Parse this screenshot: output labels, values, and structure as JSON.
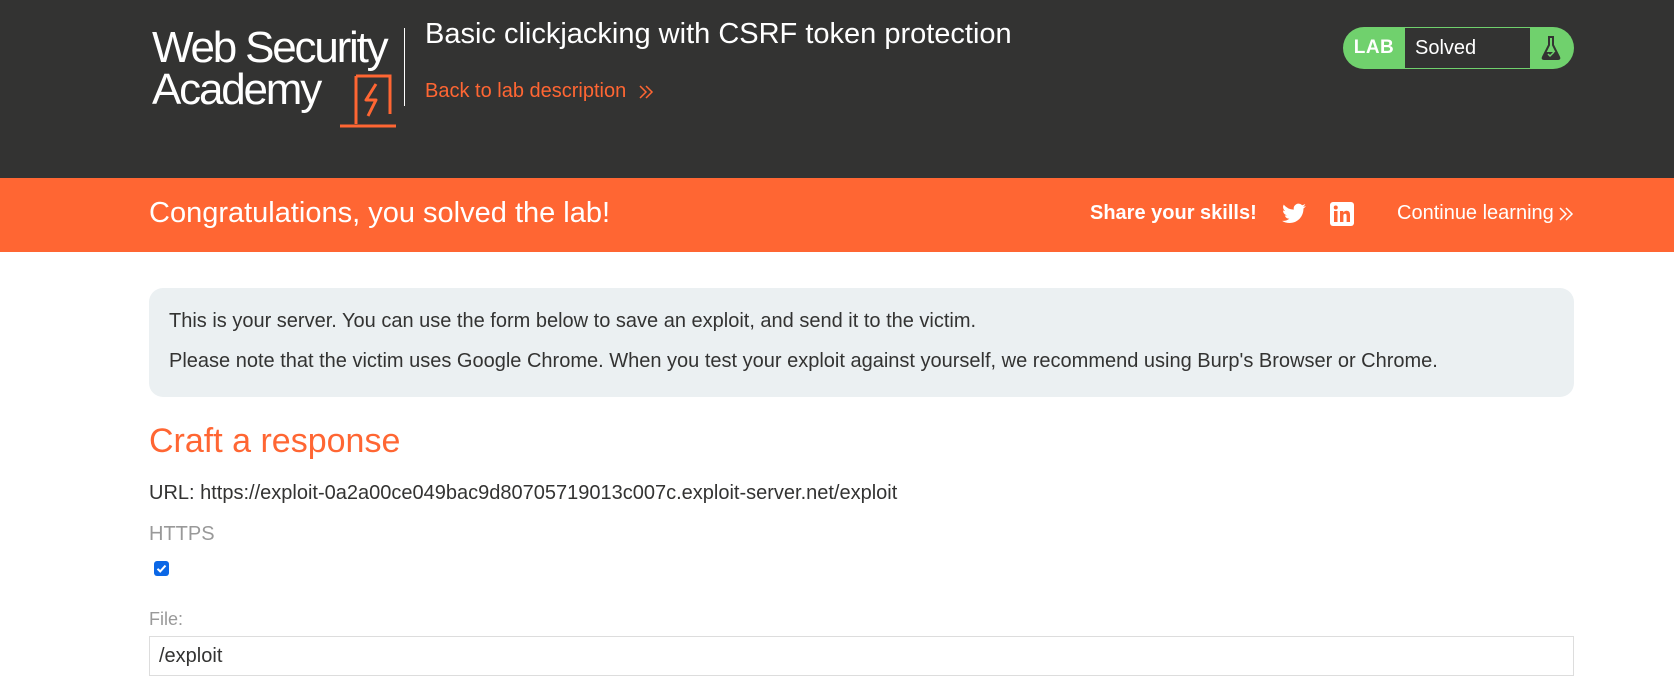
{
  "header": {
    "logo": {
      "line1": "Web Security",
      "line2": "Academy"
    },
    "lab_title": "Basic clickjacking with CSRF token protection",
    "back_link": "Back to lab description",
    "lab_status": {
      "label": "LAB",
      "value": "Solved",
      "icon": "flask-icon"
    }
  },
  "banner": {
    "message": "Congratulations, you solved the lab!",
    "share_label": "Share your skills!",
    "share_icons": [
      "twitter-icon",
      "linkedin-icon"
    ],
    "continue_link": "Continue learning"
  },
  "info_box": {
    "line1": "This is your server. You can use the form below to save an exploit, and send it to the victim.",
    "line2": "Please note that the victim uses Google Chrome. When you test your exploit against yourself, we recommend using Burp's Browser or Chrome."
  },
  "craft": {
    "title": "Craft a response",
    "url": "URL: https://exploit-0a2a00ce049bac9d80705719013c007c.exploit-server.net/exploit",
    "https_label": "HTTPS",
    "https_checked": true,
    "file_label": "File:",
    "file_value": "/exploit"
  },
  "colors": {
    "header_bg": "#333332",
    "accent": "#ff6633",
    "lab_solved": "#70d16d",
    "info_bg": "#ebf0f2",
    "checkbox": "#0b67e6"
  }
}
